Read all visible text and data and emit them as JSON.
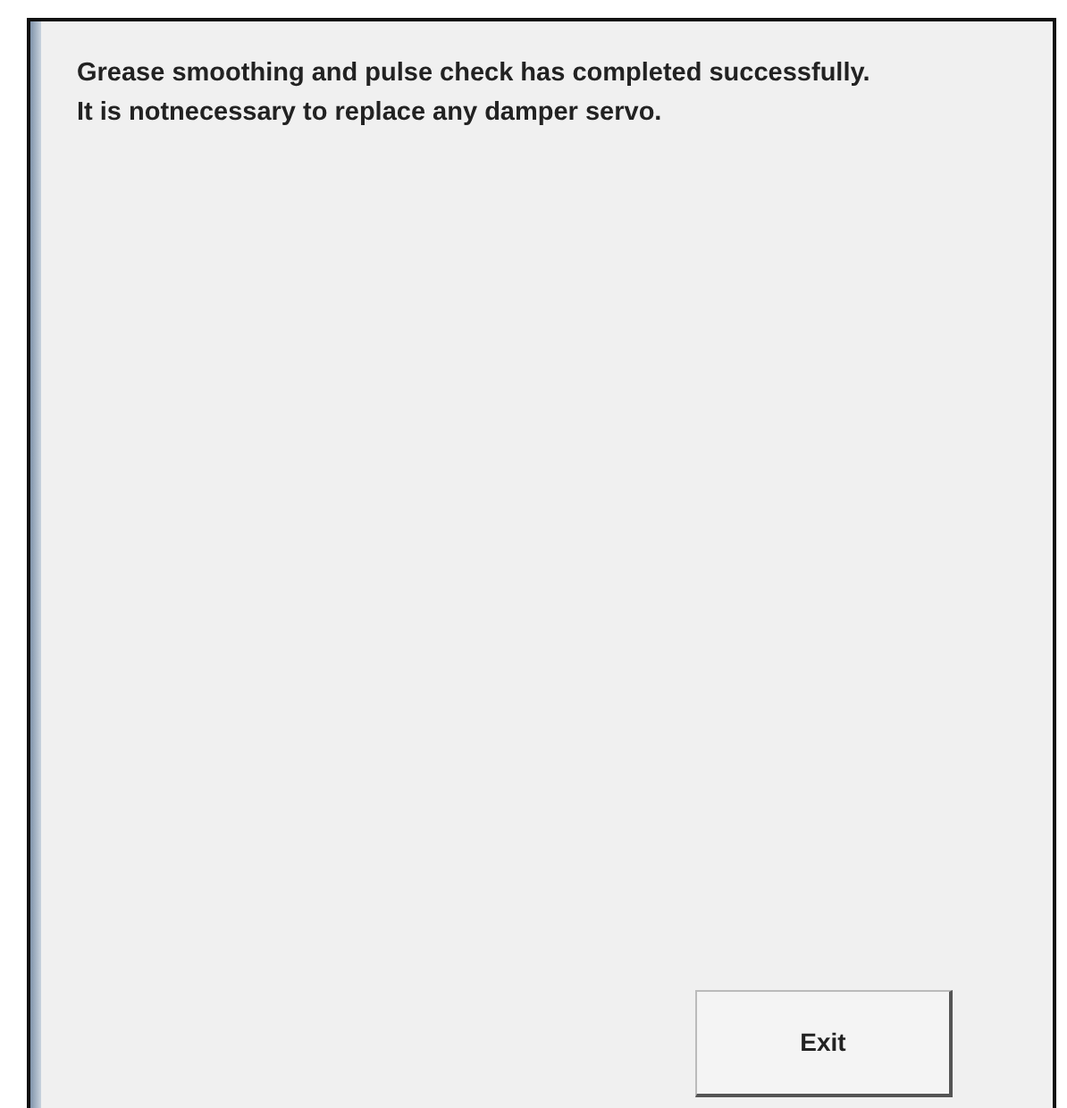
{
  "message_lines": [
    "Grease smoothing and pulse check has completed successfully.",
    "It is notnecessary to replace any damper servo."
  ],
  "buttons": [
    {
      "label": "Exit"
    }
  ]
}
